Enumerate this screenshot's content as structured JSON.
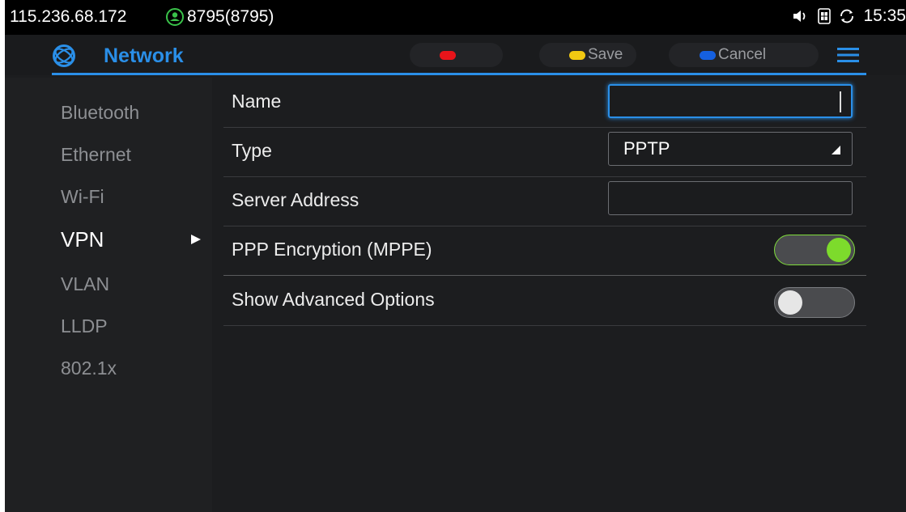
{
  "statusbar": {
    "ip": "115.236.68.172",
    "account": "8795(8795)",
    "account_icon": "account-icon",
    "icons": [
      "speaker-icon",
      "sim-icon",
      "sync-icon"
    ],
    "time": "15:35"
  },
  "header": {
    "title": "Network",
    "logo_icon": "network-globe-icon",
    "softkeys": [
      {
        "label": "",
        "color": "#e8141a"
      },
      {
        "label": "Save",
        "color": "#f2c912"
      },
      {
        "label": "Cancel",
        "color": "#1560e0"
      }
    ],
    "menu_icon": "hamburger-menu-icon",
    "accent": "#2a8fe8"
  },
  "sidebar": {
    "items": [
      {
        "label": "Bluetooth",
        "active": false
      },
      {
        "label": "Ethernet",
        "active": false
      },
      {
        "label": "Wi-Fi",
        "active": false
      },
      {
        "label": "VPN",
        "active": true
      },
      {
        "label": "VLAN",
        "active": false
      },
      {
        "label": "LLDP",
        "active": false
      },
      {
        "label": "802.1x",
        "active": false
      }
    ]
  },
  "form": {
    "name": {
      "label": "Name",
      "value": ""
    },
    "type": {
      "label": "Type",
      "value": "PPTP"
    },
    "server": {
      "label": "Server Address",
      "value": ""
    },
    "mppe": {
      "label": "PPP Encryption (MPPE)",
      "on": true
    },
    "advanced": {
      "label": "Show Advanced Options",
      "on": false
    }
  }
}
